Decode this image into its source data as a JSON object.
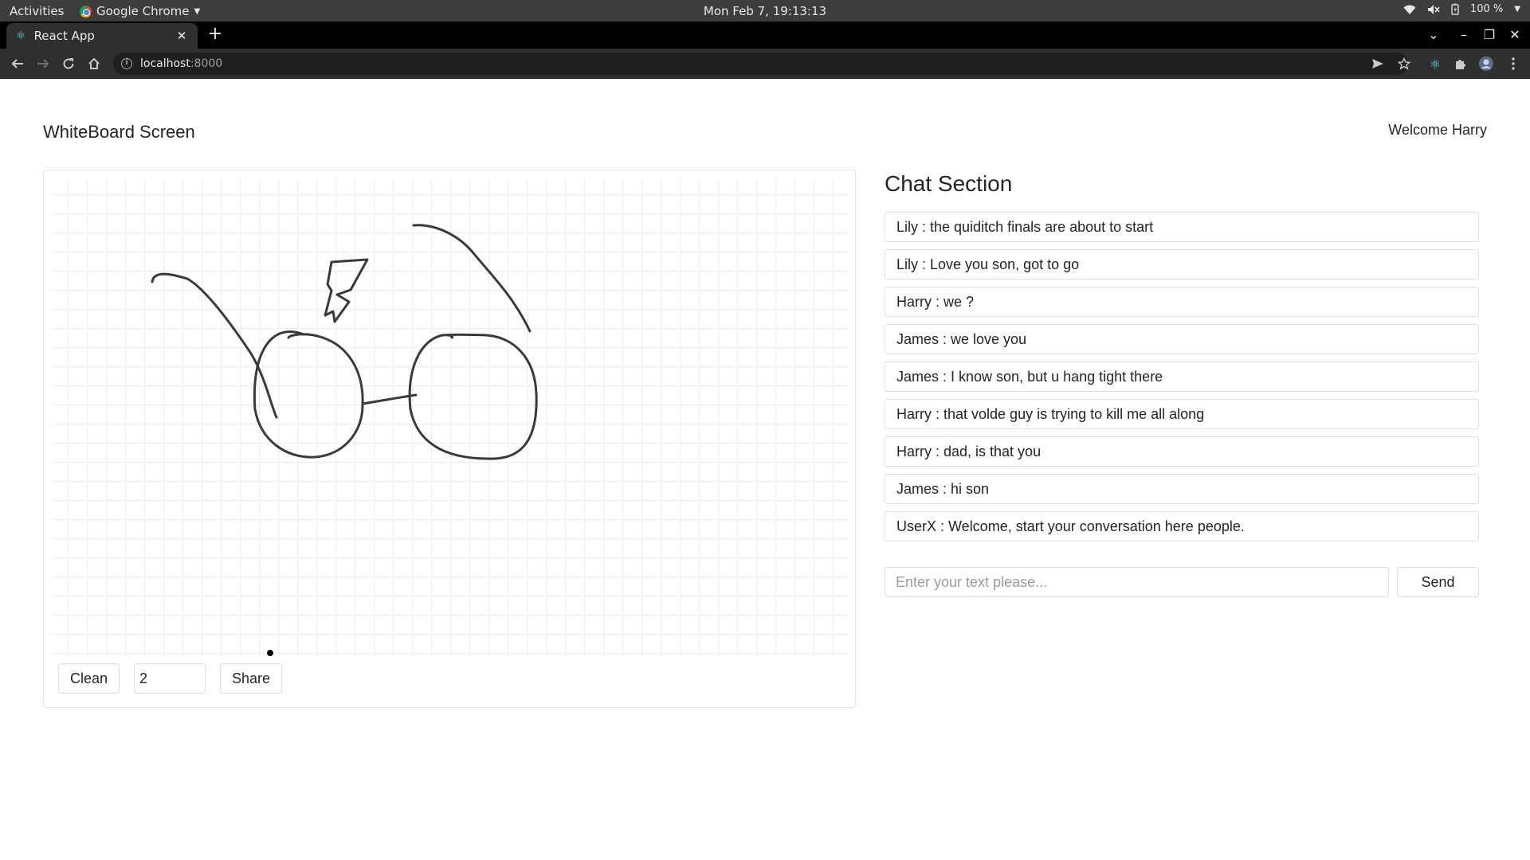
{
  "os": {
    "activities": "Activities",
    "app_name": "Google Chrome",
    "clock": "Mon Feb  7, 19:13:13",
    "battery": "100 %"
  },
  "browser": {
    "tab_title": "React App",
    "url_host": "localhost",
    "url_port": ":8000"
  },
  "page": {
    "title": "WhiteBoard Screen",
    "welcome": "Welcome Harry"
  },
  "whiteboard": {
    "clean_label": "Clean",
    "brush_size": "2",
    "share_label": "Share"
  },
  "chat": {
    "title": "Chat Section",
    "messages": [
      "Lily : the quiditch finals are about to start",
      "Lily : Love you son, got to go",
      "Harry : we ?",
      "James : we love you",
      "James : I know son, but u hang tight there",
      "Harry : that volde guy is trying to kill me all along",
      "Harry : dad, is that you",
      "James : hi son",
      "UserX : Welcome, start your conversation here people."
    ],
    "input_placeholder": "Enter your text please...",
    "send_label": "Send"
  },
  "colors": {
    "os_bar": "#3d3d3b",
    "tab_strip": "#000000",
    "toolbar": "#2f2f30",
    "ink": "#3a3a3a",
    "grid": "#ececec"
  }
}
